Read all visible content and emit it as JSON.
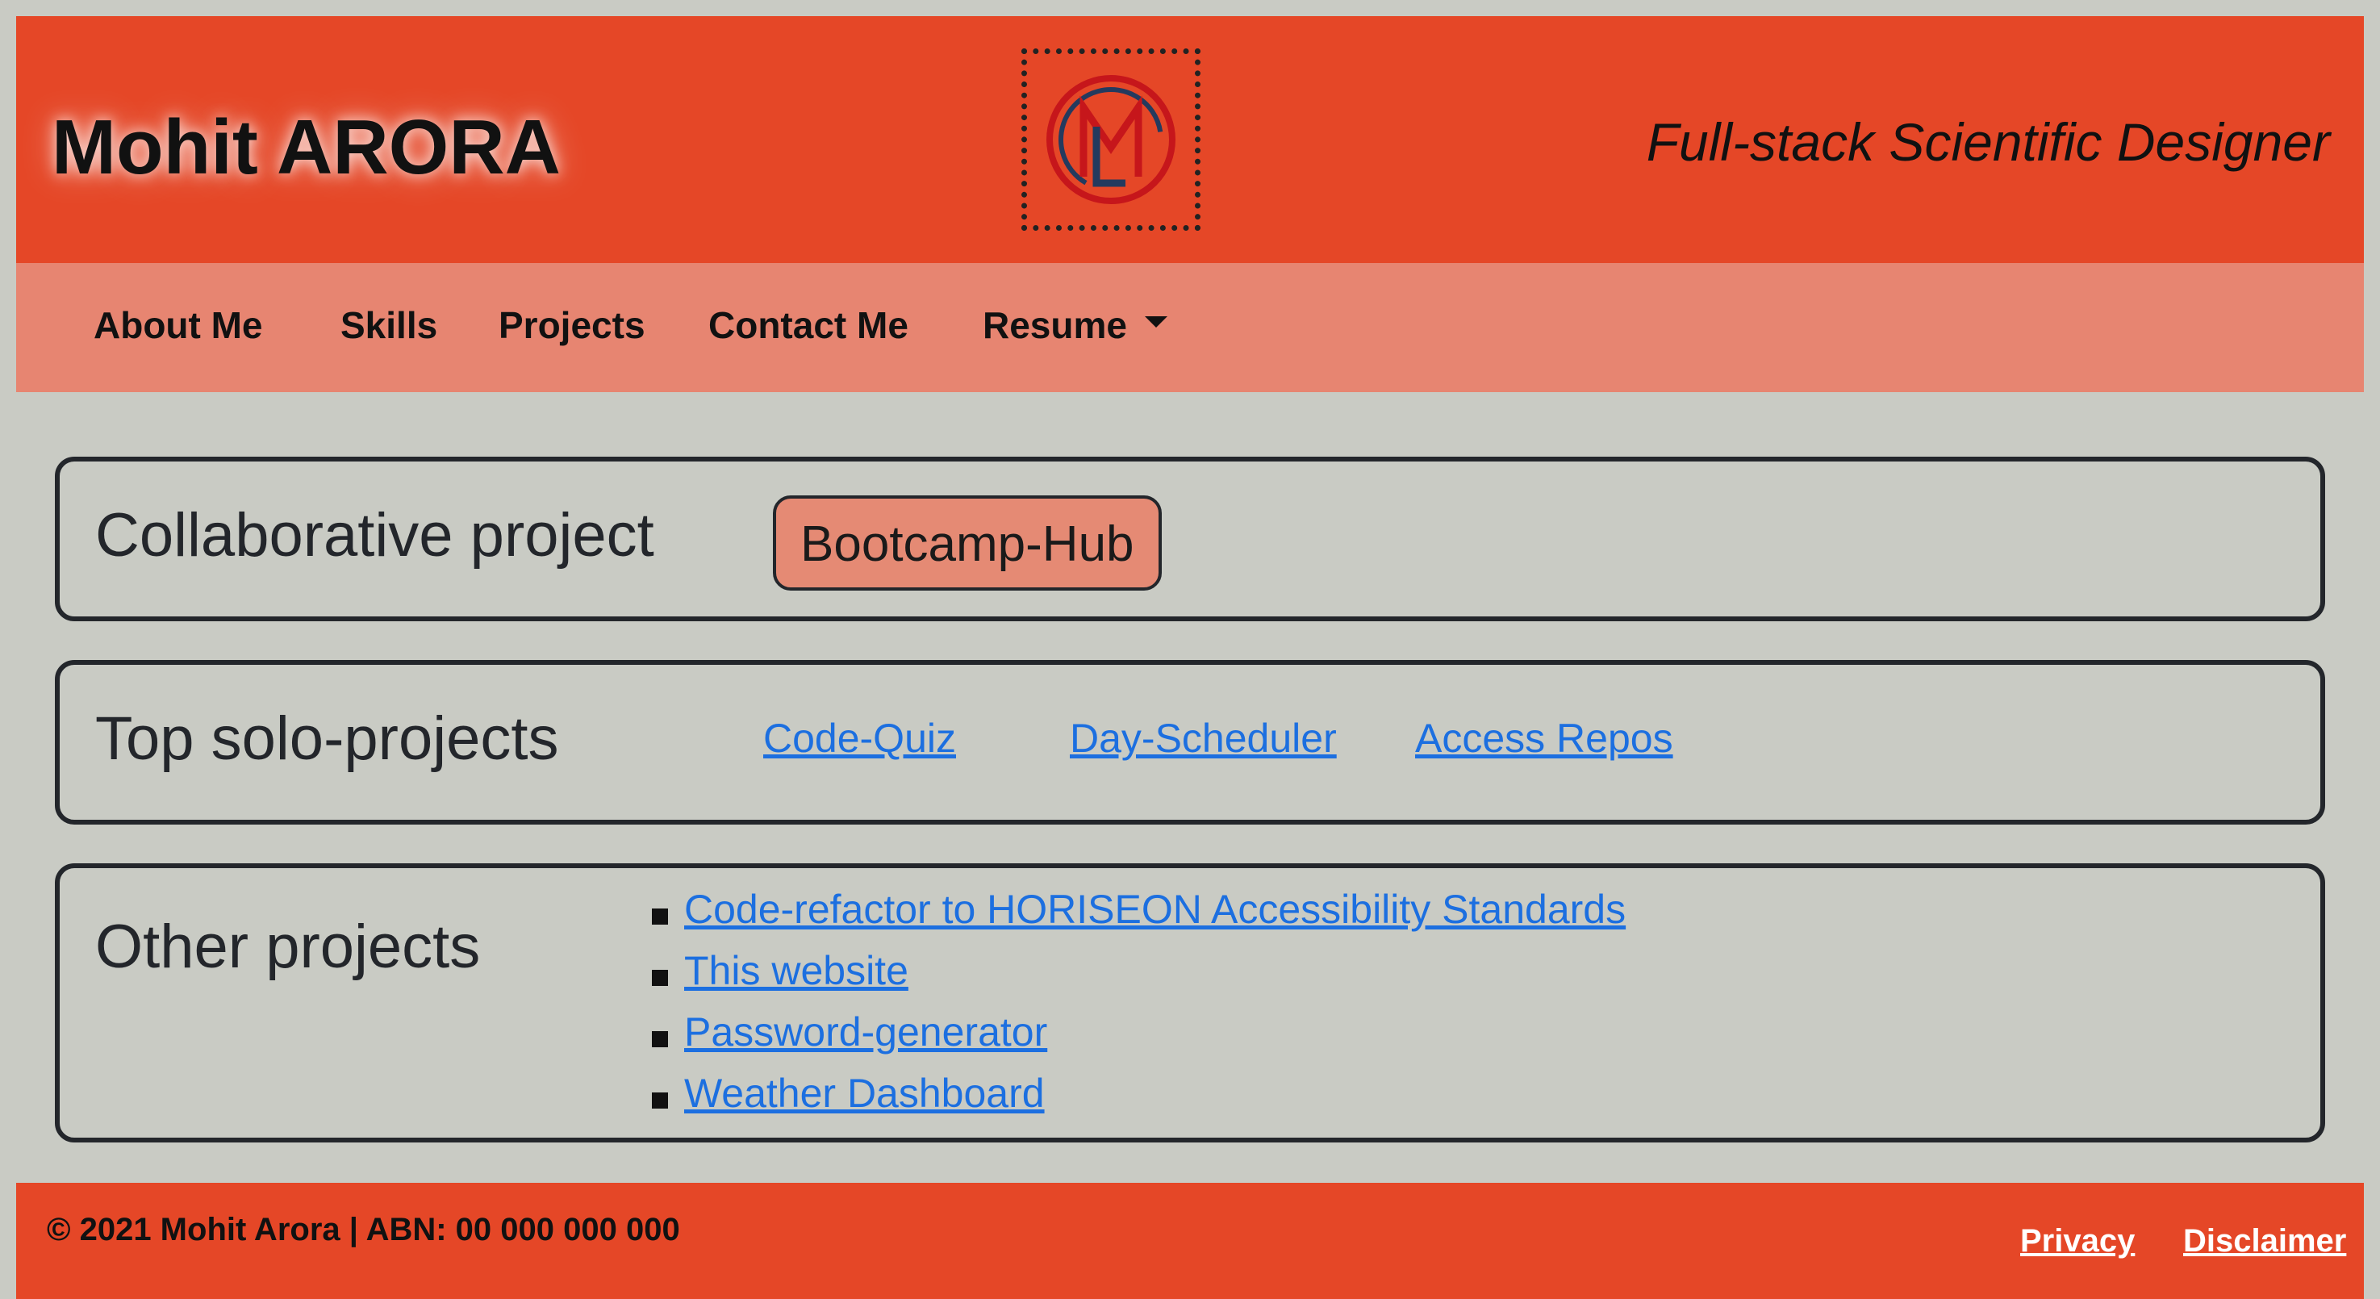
{
  "header": {
    "brand": "Mohit ARORA",
    "tagline": "Full-stack Scientific Designer",
    "logo_icon": "mohit-monogram-logo"
  },
  "nav": {
    "items": [
      {
        "label": "About Me"
      },
      {
        "label": "Skills"
      },
      {
        "label": "Projects"
      },
      {
        "label": "Contact Me"
      },
      {
        "label": "Resume",
        "dropdown": true
      }
    ]
  },
  "collaborative": {
    "title": "Collaborative project",
    "project": "Bootcamp-Hub"
  },
  "solo": {
    "title": "Top solo-projects",
    "links": [
      "Code-Quiz",
      "Day-Scheduler",
      "Access Repos"
    ]
  },
  "other": {
    "title": "Other projects",
    "links": [
      "Code-refactor to HORISEON Accessibility Standards",
      "This website",
      "Password-generator",
      "Weather Dashboard"
    ]
  },
  "footer": {
    "copyright": "© 2021 Mohit Arora | ABN: 00 000 000 000",
    "privacy": "Privacy",
    "disclaimer": "Disclaimer"
  },
  "colors": {
    "header_bg": "#e54727",
    "nav_bg": "#e78571",
    "page_bg": "#c9cbc4",
    "link": "#1c6fe0",
    "pill_bg": "#e58a74"
  }
}
